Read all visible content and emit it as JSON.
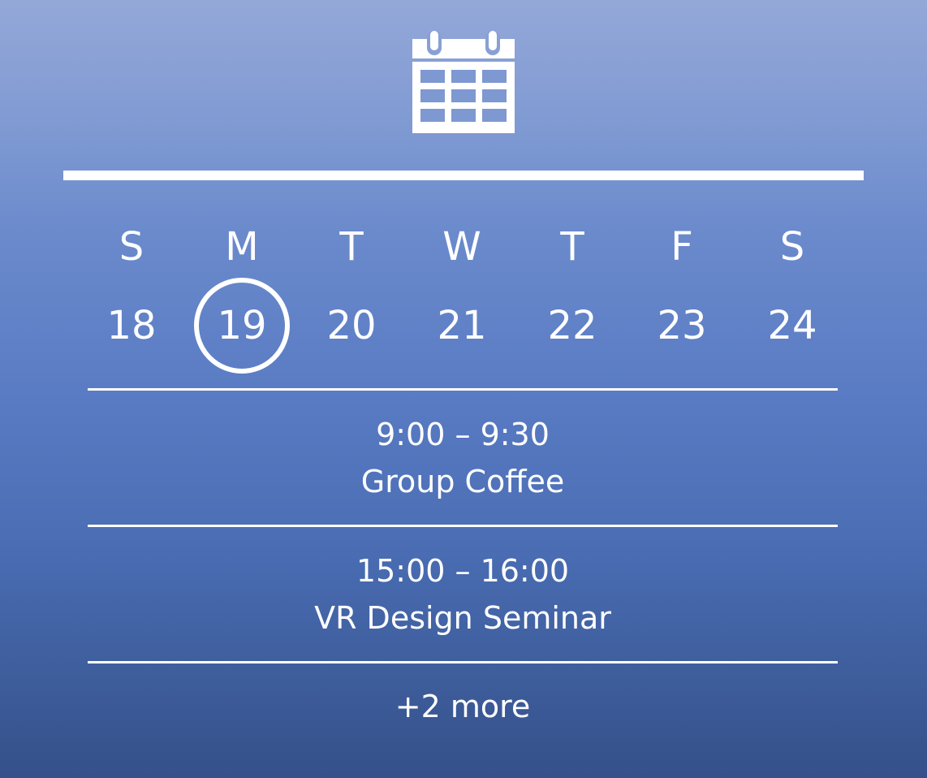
{
  "header": {
    "icon": "calendar-icon"
  },
  "week": {
    "days": [
      {
        "letter": "S",
        "date": "18",
        "is_today": false
      },
      {
        "letter": "M",
        "date": "19",
        "is_today": true
      },
      {
        "letter": "T",
        "date": "20",
        "is_today": false
      },
      {
        "letter": "W",
        "date": "21",
        "is_today": false
      },
      {
        "letter": "T",
        "date": "22",
        "is_today": false
      },
      {
        "letter": "F",
        "date": "23",
        "is_today": false
      },
      {
        "letter": "S",
        "date": "24",
        "is_today": false
      }
    ]
  },
  "events": [
    {
      "time": "9:00 – 9:30",
      "title": "Group Coffee"
    },
    {
      "time": "15:00 – 16:00",
      "title": "VR Design Seminar"
    }
  ],
  "more_label": "+2 more",
  "colors": {
    "background_top": "#94a8d8",
    "background_bottom": "#35508a",
    "foreground": "#ffffff"
  }
}
